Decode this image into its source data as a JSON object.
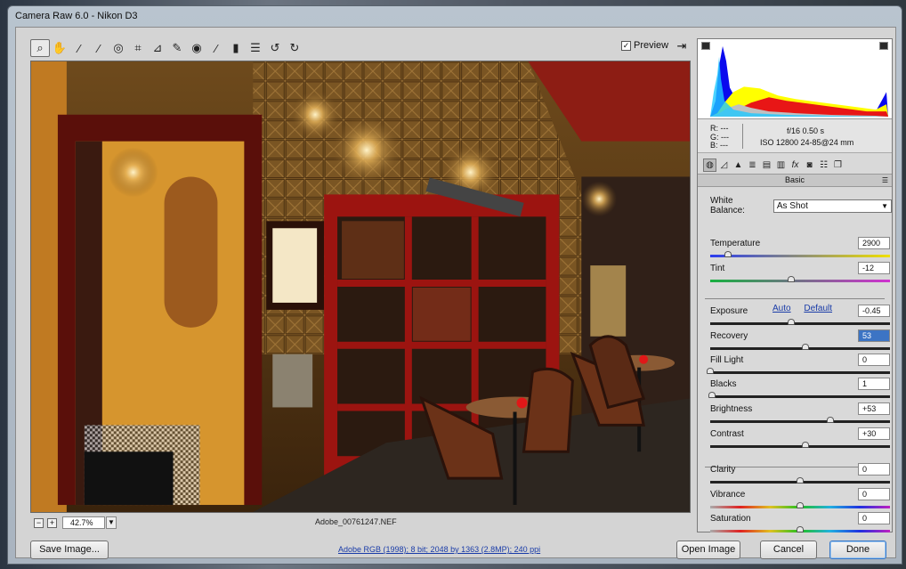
{
  "window": {
    "title": "Camera Raw 6.0  -  Nikon D3"
  },
  "toolbar": {
    "tools": [
      {
        "icon": "zoom-icon",
        "glyph": "⌕"
      },
      {
        "icon": "hand-icon",
        "glyph": "✋"
      },
      {
        "icon": "white-balance-eyedropper-icon",
        "glyph": "⁄"
      },
      {
        "icon": "color-sampler-icon",
        "glyph": "⁄"
      },
      {
        "icon": "target-adjustment-icon",
        "glyph": "◎"
      },
      {
        "icon": "crop-icon",
        "glyph": "⌗"
      },
      {
        "icon": "straighten-icon",
        "glyph": "⊿"
      },
      {
        "icon": "spot-removal-icon",
        "glyph": "✎"
      },
      {
        "icon": "red-eye-icon",
        "glyph": "◉"
      },
      {
        "icon": "adjustment-brush-icon",
        "glyph": "⁄"
      },
      {
        "icon": "graduated-filter-icon",
        "glyph": "▮"
      },
      {
        "icon": "preferences-icon",
        "glyph": "☰"
      },
      {
        "icon": "rotate-left-icon",
        "glyph": "↺"
      },
      {
        "icon": "rotate-right-icon",
        "glyph": "↻"
      }
    ],
    "preview_label": "Preview",
    "preview_checked": true
  },
  "zoom": {
    "value": "42.7%",
    "filename": "Adobe_00761247.NEF"
  },
  "info": {
    "r": "R:  ---",
    "g": "G:  ---",
    "b": "B:  ---",
    "exif_line1": "f/16   0.50 s",
    "exif_line2": "ISO 12800   24-85@24 mm"
  },
  "panel": {
    "title": "Basic"
  },
  "white_balance": {
    "label": "White Balance:",
    "value": "As Shot"
  },
  "links": {
    "auto": "Auto",
    "default": "Default"
  },
  "sliders": [
    {
      "key": "temperature",
      "label": "Temperature",
      "value": "2900",
      "pos": 0.1,
      "track": "temp"
    },
    {
      "key": "tint",
      "label": "Tint",
      "value": "-12",
      "pos": 0.45,
      "track": "tint"
    },
    {
      "key": "exposure",
      "label": "Exposure",
      "value": "-0.45",
      "pos": 0.45,
      "track": "dark"
    },
    {
      "key": "recovery",
      "label": "Recovery",
      "value": "53",
      "pos": 0.53,
      "track": "dark",
      "highlight": true
    },
    {
      "key": "fill-light",
      "label": "Fill Light",
      "value": "0",
      "pos": 0.0,
      "track": "dark"
    },
    {
      "key": "blacks",
      "label": "Blacks",
      "value": "1",
      "pos": 0.01,
      "track": "dark"
    },
    {
      "key": "brightness",
      "label": "Brightness",
      "value": "+53",
      "pos": 0.67,
      "track": "dark"
    },
    {
      "key": "contrast",
      "label": "Contrast",
      "value": "+30",
      "pos": 0.53,
      "track": "dark"
    },
    {
      "key": "clarity",
      "label": "Clarity",
      "value": "0",
      "pos": 0.5,
      "track": "dark"
    },
    {
      "key": "vibrance",
      "label": "Vibrance",
      "value": "0",
      "pos": 0.5,
      "track": "rainbow"
    },
    {
      "key": "saturation",
      "label": "Saturation",
      "value": "0",
      "pos": 0.5,
      "track": "rainbow"
    }
  ],
  "bottom": {
    "save_label": "Save Image...",
    "workflow_link": "Adobe RGB (1998); 8 bit; 2048 by 1363 (2.8MP); 240 ppi",
    "open_label": "Open Image",
    "cancel_label": "Cancel",
    "done_label": "Done"
  },
  "colors": {
    "link": "#1a3ca8",
    "accent": "#3778c8"
  }
}
